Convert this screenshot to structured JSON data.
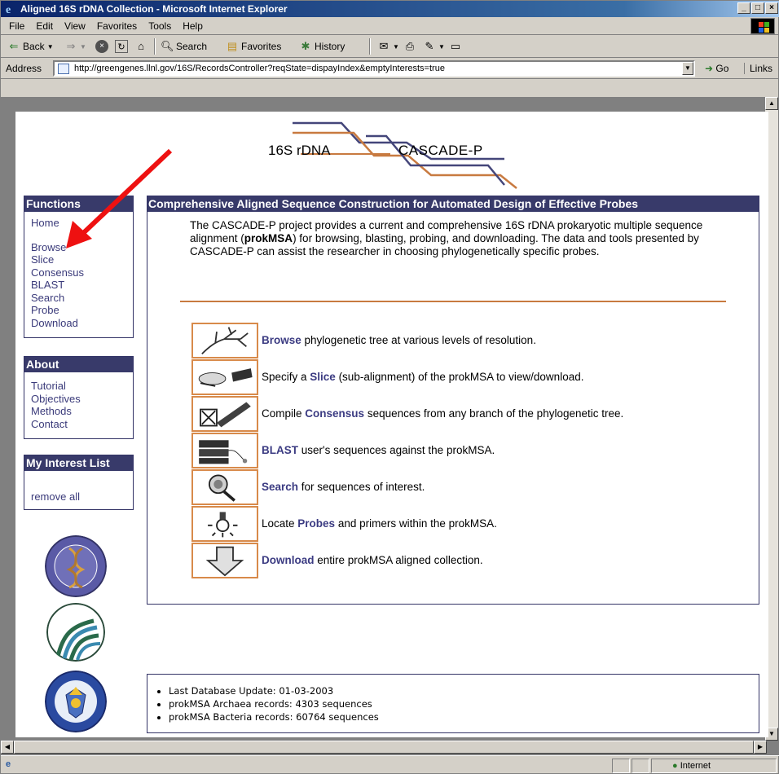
{
  "window": {
    "title": "Aligned 16S rDNA Collection - Microsoft Internet Explorer",
    "min": "_",
    "max": "□",
    "close": "×"
  },
  "menu": [
    "File",
    "Edit",
    "View",
    "Favorites",
    "Tools",
    "Help"
  ],
  "toolbar": {
    "back": "Back",
    "search": "Search",
    "favorites": "Favorites",
    "history": "History"
  },
  "address": {
    "label": "Address",
    "url": "http://greengenes.llnl.gov/16S/RecordsController?reqState=dispayIndex&emptyInterests=true",
    "go": "Go",
    "links": "Links"
  },
  "banner": {
    "left": "16S rDNA",
    "right": "CASCADE-P"
  },
  "functions": {
    "header": "Functions",
    "items": [
      "Home",
      "Browse",
      "Slice",
      "Consensus",
      "BLAST",
      "Search",
      "Probe",
      "Download"
    ]
  },
  "about": {
    "header": "About",
    "items": [
      "Tutorial",
      "Objectives",
      "Methods",
      "Contact"
    ]
  },
  "interest": {
    "header": "My Interest List",
    "remove_all": "remove all"
  },
  "main": {
    "header": "Comprehensive Aligned Sequence Construction for Automated Design of Effective Probes",
    "intro_a": "The CASCADE-P project provides a current and comprehensive 16S rDNA prokaryotic multiple sequence alignment (",
    "intro_b": "prokMSA",
    "intro_c": ") for browsing, blasting, probing, and downloading.  The data and tools presented by CASCADE-P can assist the researcher in choosing phylogenetically specific probes.",
    "features": [
      {
        "pre": "",
        "kw": "Browse",
        "post": " phylogenetic tree at various levels of resolution."
      },
      {
        "pre": "Specify a ",
        "kw": "Slice",
        "post": " (sub-alignment) of the prokMSA to view/download."
      },
      {
        "pre": "Compile ",
        "kw": "Consensus",
        "post": " sequences from any branch of the phylogenetic tree."
      },
      {
        "pre": "",
        "kw": "BLAST",
        "post": " user's sequences against the prokMSA."
      },
      {
        "pre": "",
        "kw": "Search",
        "post": " for sequences of interest."
      },
      {
        "pre": "Locate ",
        "kw": "Probes",
        "post": " and primers within the prokMSA."
      },
      {
        "pre": "",
        "kw": "Download",
        "post": " entire prokMSA aligned collection."
      }
    ]
  },
  "footer": {
    "items": [
      "Last Database Update: 01-03-2003",
      "prokMSA Archaea records: 4303 sequences",
      "prokMSA Bacteria records: 60764 sequences"
    ]
  },
  "status": {
    "zone": "Internet"
  }
}
